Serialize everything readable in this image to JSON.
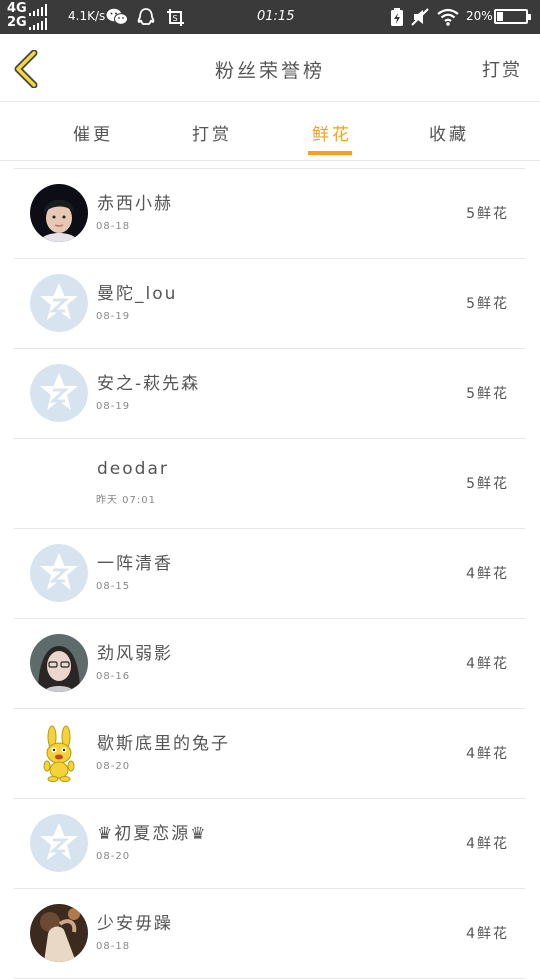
{
  "status_bar": {
    "network_top": "4G",
    "network_bottom": "2G",
    "speed": "4.1K/s",
    "time": "01:15",
    "battery_percent": "20%",
    "battery_level": 0.2,
    "icons": [
      "wechat-icon",
      "qq-icon",
      "screenshot-icon",
      "battery-saver-icon",
      "mute-icon",
      "wifi-icon"
    ]
  },
  "header": {
    "back_icon": "chevron-left-icon",
    "title": "粉丝荣誉榜",
    "right_action": "打赏"
  },
  "tabs": [
    {
      "label": "催更",
      "active": false
    },
    {
      "label": "打赏",
      "active": false
    },
    {
      "label": "鲜花",
      "active": true
    },
    {
      "label": "收藏",
      "active": false
    }
  ],
  "accent_color": "#f5a11f",
  "list": [
    {
      "name": "赤西小赫",
      "date": "08-18",
      "count": "5鲜花",
      "avatar": "photo-boy"
    },
    {
      "name": "曼陀_lou",
      "date": "08-19",
      "count": "5鲜花",
      "avatar": "default-z"
    },
    {
      "name": "安之-萩先森",
      "date": "08-19",
      "count": "5鲜花",
      "avatar": "default-z"
    },
    {
      "name": "deodar",
      "date": "昨天 07:01",
      "count": "5鲜花",
      "avatar": "none"
    },
    {
      "name": "一阵清香",
      "date": "08-15",
      "count": "4鲜花",
      "avatar": "default-z"
    },
    {
      "name": "劲风弱影",
      "date": "08-16",
      "count": "4鲜花",
      "avatar": "photo-girl"
    },
    {
      "name": "歇斯底里的兔子",
      "date": "08-20",
      "count": "4鲜花",
      "avatar": "bunny"
    },
    {
      "name": "♛初夏恋源♛",
      "date": "08-20",
      "count": "4鲜花",
      "avatar": "default-z"
    },
    {
      "name": "少安毋躁",
      "date": "08-18",
      "count": "4鲜花",
      "avatar": "photo-hand"
    }
  ]
}
